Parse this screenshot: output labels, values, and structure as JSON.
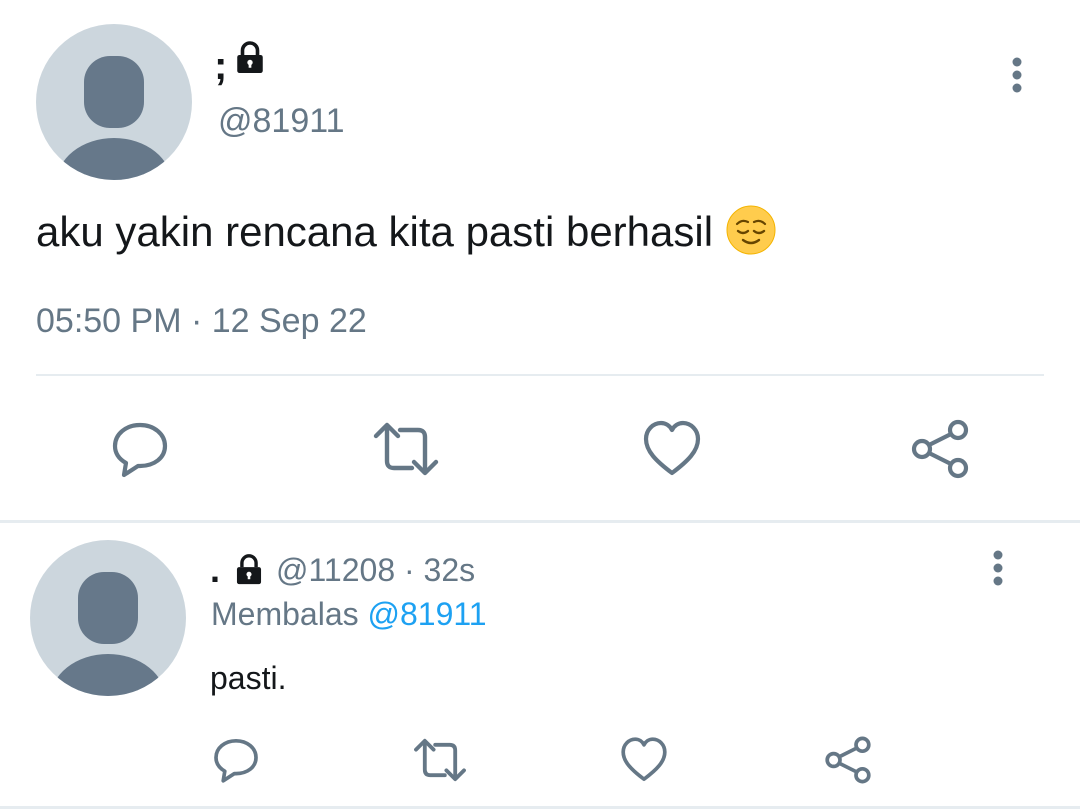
{
  "main_tweet": {
    "display_name": ";",
    "handle": "@81911",
    "text": "aku yakin rencana kita pasti berhasil",
    "emoji": "relieved-face-emoji",
    "timestamp": "05:50 PM · 12 Sep 22"
  },
  "reply_tweet": {
    "display_name": ".",
    "handle_time": "@11208 · 32s",
    "replying_prefix": "Membalas",
    "replying_to": "@81911",
    "text": "pasti."
  },
  "icons": {
    "protected": "lock-icon",
    "more": "more-vertical-icon",
    "reply": "reply-icon",
    "retweet": "retweet-icon",
    "like": "heart-icon",
    "share": "share-icon"
  },
  "colors": {
    "text": "#14171a",
    "secondary": "#657786",
    "link": "#1da1f2",
    "avatar_bg": "#ccd6dd",
    "avatar_fg": "#66788a",
    "divider": "#e6ecf0"
  }
}
